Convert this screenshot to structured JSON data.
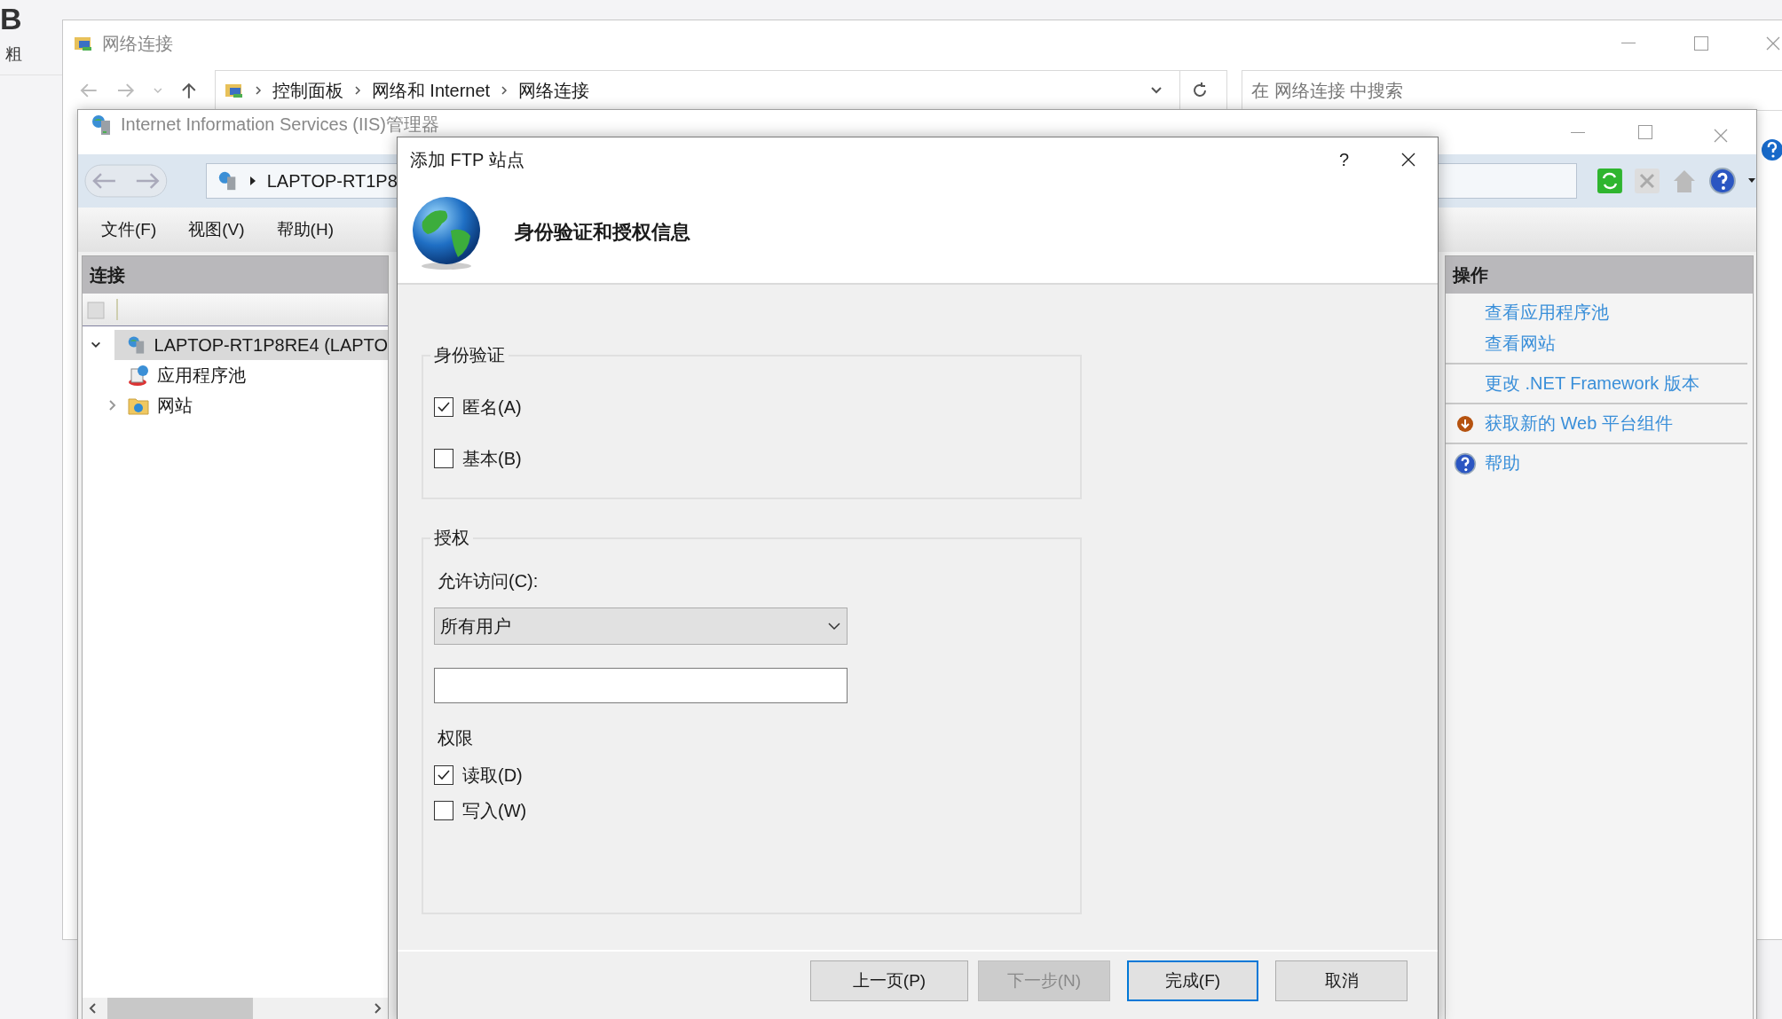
{
  "background_app": {
    "bold_key": "B",
    "toolbar_label": "粗"
  },
  "explorer": {
    "title": "网络连接",
    "breadcrumb": [
      "控制面板",
      "网络和 Internet",
      "网络连接"
    ],
    "search": {
      "placeholder": "在 网络连接 中搜索"
    }
  },
  "iis": {
    "title": "Internet Information Services (IIS)管理器",
    "address": "LAPTOP-RT1P8",
    "menu": [
      "文件(F)",
      "视图(V)",
      "帮助(H)"
    ],
    "connections": {
      "title": "连接",
      "tree": [
        {
          "label": "LAPTOP-RT1P8RE4 (LAPTO",
          "kind": "server",
          "selected": true,
          "expanded": true,
          "children": [
            {
              "label": "应用程序池",
              "kind": "pool",
              "selected": false
            },
            {
              "label": "网站",
              "kind": "sites",
              "selected": false,
              "expanded": false
            }
          ]
        }
      ]
    },
    "actions": {
      "title": "操作",
      "groups": [
        [
          {
            "label": "查看应用程序池",
            "kind": "link"
          },
          {
            "label": "查看网站",
            "kind": "link"
          }
        ],
        [
          {
            "label": "更改 .NET Framework 版本",
            "kind": "link"
          }
        ],
        [
          {
            "label": "获取新的 Web 平台组件",
            "kind": "download"
          }
        ],
        [
          {
            "label": "帮助",
            "kind": "help"
          }
        ]
      ]
    }
  },
  "dialog": {
    "title": "添加 FTP 站点",
    "help": "?",
    "heading": "身份验证和授权信息",
    "authentication": {
      "legend": "身份验证",
      "options": [
        {
          "label": "匿名(A)",
          "checked": true
        },
        {
          "label": "基本(B)",
          "checked": false
        }
      ]
    },
    "authorization": {
      "legend": "授权",
      "access_label": "允许访问(C):",
      "access_value": "所有用户",
      "permissions_label": "权限",
      "permissions": [
        {
          "label": "读取(D)",
          "checked": true
        },
        {
          "label": "写入(W)",
          "checked": false
        }
      ]
    },
    "buttons": [
      {
        "label": "上一页(P)",
        "disabled": false,
        "default": false
      },
      {
        "label": "下一步(N)",
        "disabled": true,
        "default": false
      },
      {
        "label": "完成(F)",
        "disabled": false,
        "default": true
      },
      {
        "label": "取消",
        "disabled": false,
        "default": false
      }
    ]
  }
}
